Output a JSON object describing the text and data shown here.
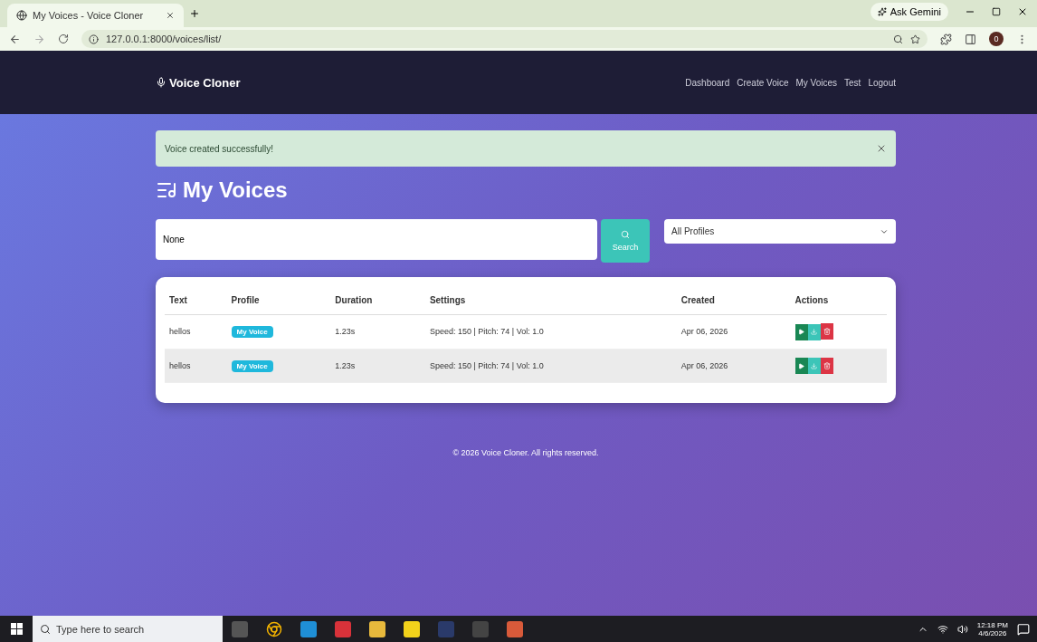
{
  "browser": {
    "tab_title": "My Voices - Voice Cloner",
    "url": "127.0.0.1:8000/voices/list/",
    "gemini": "Ask Gemini",
    "profile_initial": "0"
  },
  "navbar": {
    "brand": "Voice Cloner",
    "links": [
      "Dashboard",
      "Create Voice",
      "My Voices",
      "Test",
      "Logout"
    ]
  },
  "alert": {
    "message": "Voice created successfully!"
  },
  "page_title": "My Voices",
  "search": {
    "value": "None",
    "button": "Search",
    "profile_filter": "All Profiles"
  },
  "table": {
    "columns": [
      "Text",
      "Profile",
      "Duration",
      "Settings",
      "Created",
      "Actions"
    ],
    "rows": [
      {
        "text": "hellos",
        "profile": "My Voice",
        "duration": "1.23s",
        "settings": "Speed: 150 | Pitch: 74 | Vol: 1.0",
        "created": "Apr 06, 2026"
      },
      {
        "text": "hellos",
        "profile": "My Voice",
        "duration": "1.23s",
        "settings": "Speed: 150 | Pitch: 74 | Vol: 1.0",
        "created": "Apr 06, 2026"
      }
    ]
  },
  "footer": "© 2026 Voice Cloner. All rights reserved.",
  "taskbar": {
    "search_placeholder": "Type here to search",
    "time": "12:18 PM",
    "date": "4/6/2026"
  }
}
